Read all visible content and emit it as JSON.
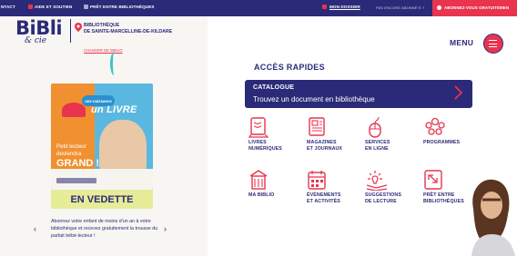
{
  "topbar": {
    "contact": "NTACT",
    "aide": "AIDE ET SOUTIEN",
    "pret": "PRÊT ENTRE BIBLIOTHÈQUES",
    "mon_dossier": "MON DOSSIER",
    "not_member": "PAS ENCORE ABONNÉ·E ?",
    "subscribe": "ABONNEZ-VOUS GRATUITEMEN"
  },
  "logo": {
    "bibli": "BiBli",
    "cie": "& cie"
  },
  "library": {
    "line1": "BIBLIOTHÈQUE",
    "line2": "DE SAINTE-MARCELLINE-DE-KILDARE",
    "change": "CHANGER DE BIBLIO"
  },
  "menu": {
    "label": "MENU"
  },
  "quick_access": {
    "title": "ACCÈS RAPIDES",
    "catalogue_title": "CATALOGUE",
    "catalogue_sub": "Trouvez un document en bibliothèque"
  },
  "tiles": [
    {
      "l1": "LIVRES",
      "l2": "NUMÉRIQUES",
      "icon": "ebook-icon"
    },
    {
      "l1": "MAGAZINES",
      "l2": "ET JOURNAUX",
      "icon": "newspaper-icon"
    },
    {
      "l1": "SERVICES",
      "l2": "EN LIGNE",
      "icon": "mouse-icon"
    },
    {
      "l1": "PROGRAMMES",
      "l2": "",
      "icon": "people-icon"
    },
    {
      "l1": "MA BIBLIO",
      "l2": "",
      "icon": "building-icon"
    },
    {
      "l1": "ÉVÈNEMENTS",
      "l2": "ET ACTIVITÉS",
      "icon": "calendar-icon"
    },
    {
      "l1": "SUGGESTIONS",
      "l2": "DE LECTURE",
      "icon": "reading-lamp-icon"
    },
    {
      "l1": "PRÊT ENTRE",
      "l2": "BIBLIOTHÈQUES",
      "icon": "transfer-icon"
    }
  ],
  "poster": {
    "badge": "une naissance",
    "livre": "un LIVRE",
    "line1": "Petit lecteur",
    "line2": "deviendra",
    "grand": "GRAND !"
  },
  "vedette": {
    "title": "EN VEDETTE",
    "text": "Abonnez votre enfant de moins d'un an à votre bibliothèque et recevez gratuitement la trousse du parfait bébé-lecteur !"
  },
  "colors": {
    "navy": "#2b2a78",
    "red": "#e8344e",
    "teal": "#3fc4c0",
    "yellow_green": "#e6ec98"
  }
}
